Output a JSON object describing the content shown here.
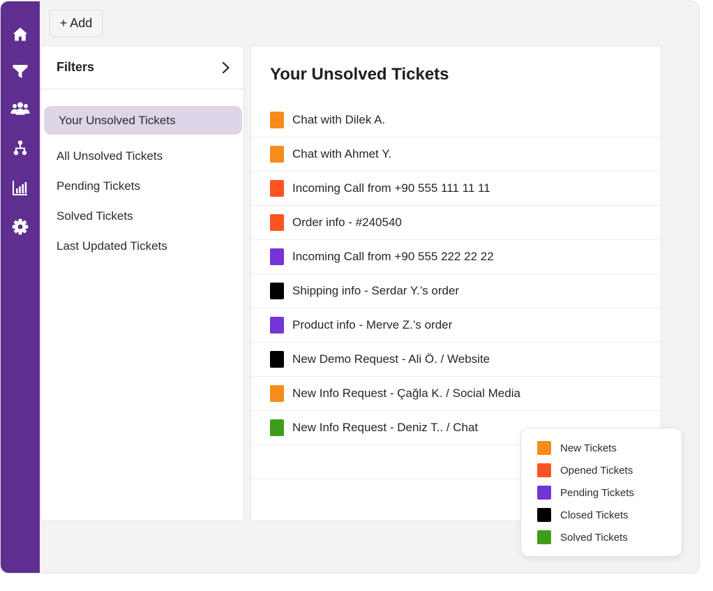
{
  "nav": {
    "items": [
      {
        "icon": "home-icon"
      },
      {
        "icon": "filter-icon"
      },
      {
        "icon": "users-icon"
      },
      {
        "icon": "org-chart-icon"
      },
      {
        "icon": "bar-chart-icon"
      },
      {
        "icon": "gear-icon"
      }
    ],
    "color": "#5e2f8f"
  },
  "toolbar": {
    "add_label": "+ Add"
  },
  "filters": {
    "title": "Filters",
    "items": [
      {
        "label": "Your Unsolved Tickets",
        "active": true
      },
      {
        "label": "All Unsolved Tickets"
      },
      {
        "label": "Pending Tickets"
      },
      {
        "label": "Solved Tickets"
      },
      {
        "label": "Last Updated Tickets"
      }
    ]
  },
  "tickets": {
    "title": "Your Unsolved Tickets",
    "rows": [
      {
        "label": "Chat with Dilek A.",
        "status": "new"
      },
      {
        "label": "Chat with Ahmet Y.",
        "status": "new"
      },
      {
        "label": "Incoming Call from +90 555 111 11 11",
        "status": "opened"
      },
      {
        "label": "Order info - #240540",
        "status": "opened"
      },
      {
        "label": "Incoming Call from +90 555 222 22 22",
        "status": "pending"
      },
      {
        "label": "Shipping info - Serdar Y.’s order",
        "status": "closed"
      },
      {
        "label": "Product info - Merve Z.’s order",
        "status": "pending"
      },
      {
        "label": "New Demo Request - Ali Ö. / Website",
        "status": "closed"
      },
      {
        "label": "New Info Request - Çağla K. / Social Media",
        "status": "new"
      },
      {
        "label": "New Info Request - Deniz T.. / Chat",
        "status": "solved"
      }
    ]
  },
  "legend": {
    "items": [
      {
        "key": "new",
        "label": "New Tickets",
        "color": "#f78c1b"
      },
      {
        "key": "opened",
        "label": "Opened Tickets",
        "color": "#fc5420"
      },
      {
        "key": "pending",
        "label": "Pending Tickets",
        "color": "#7535d6"
      },
      {
        "key": "closed",
        "label": "Closed Tickets",
        "color": "#000000"
      },
      {
        "key": "solved",
        "label": "Solved Tickets",
        "color": "#3e9d18"
      }
    ]
  }
}
